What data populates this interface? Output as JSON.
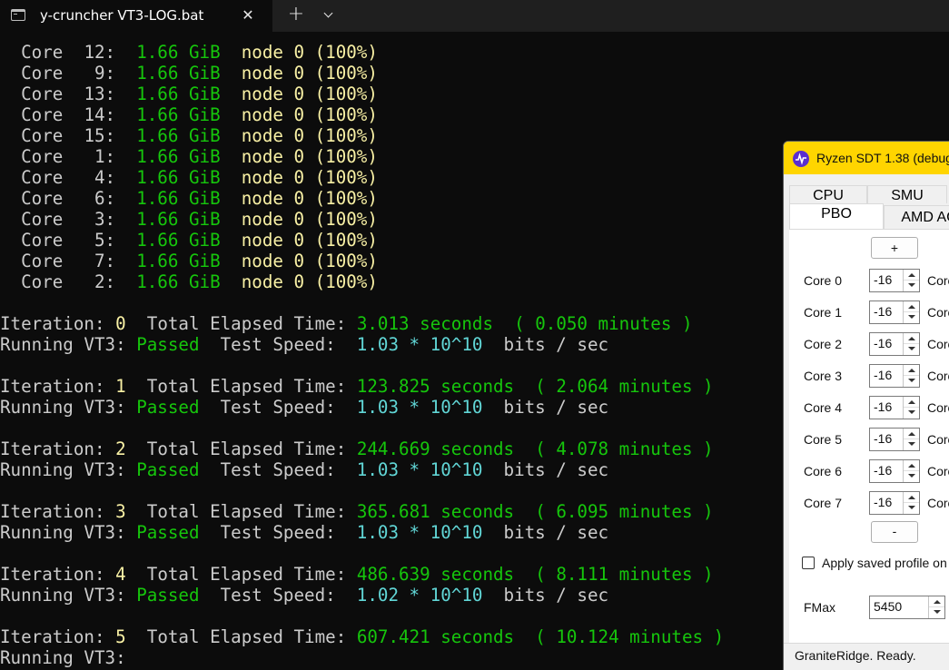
{
  "terminal": {
    "tab_title": "y-cruncher VT3-LOG.bat",
    "close_glyph": "✕",
    "new_tab_glyph": "+",
    "core_rows": [
      {
        "label": "Core",
        "num": "12:",
        "mem": "1.66 GiB",
        "node": "node 0 (100%)"
      },
      {
        "label": "Core",
        "num": " 9:",
        "mem": "1.66 GiB",
        "node": "node 0 (100%)"
      },
      {
        "label": "Core",
        "num": "13:",
        "mem": "1.66 GiB",
        "node": "node 0 (100%)"
      },
      {
        "label": "Core",
        "num": "14:",
        "mem": "1.66 GiB",
        "node": "node 0 (100%)"
      },
      {
        "label": "Core",
        "num": "15:",
        "mem": "1.66 GiB",
        "node": "node 0 (100%)"
      },
      {
        "label": "Core",
        "num": " 1:",
        "mem": "1.66 GiB",
        "node": "node 0 (100%)"
      },
      {
        "label": "Core",
        "num": " 4:",
        "mem": "1.66 GiB",
        "node": "node 0 (100%)"
      },
      {
        "label": "Core",
        "num": " 6:",
        "mem": "1.66 GiB",
        "node": "node 0 (100%)"
      },
      {
        "label": "Core",
        "num": " 3:",
        "mem": "1.66 GiB",
        "node": "node 0 (100%)"
      },
      {
        "label": "Core",
        "num": " 5:",
        "mem": "1.66 GiB",
        "node": "node 0 (100%)"
      },
      {
        "label": "Core",
        "num": " 7:",
        "mem": "1.66 GiB",
        "node": "node 0 (100%)"
      },
      {
        "label": "Core",
        "num": " 2:",
        "mem": "1.66 GiB",
        "node": "node 0 (100%)"
      }
    ],
    "iterations": [
      {
        "label": "Iteration:",
        "num": "0",
        "elapsed_label": "Total Elapsed Time:",
        "seconds": "3.013 seconds",
        "minutes": "( 0.050 minutes )",
        "running": "Running VT3:",
        "status": "Passed",
        "speed_label": "Test Speed:",
        "speed": "1.03 * 10^10",
        "unit": "bits / sec"
      },
      {
        "label": "Iteration:",
        "num": "1",
        "elapsed_label": "Total Elapsed Time:",
        "seconds": "123.825 seconds",
        "minutes": "( 2.064 minutes )",
        "running": "Running VT3:",
        "status": "Passed",
        "speed_label": "Test Speed:",
        "speed": "1.03 * 10^10",
        "unit": "bits / sec"
      },
      {
        "label": "Iteration:",
        "num": "2",
        "elapsed_label": "Total Elapsed Time:",
        "seconds": "244.669 seconds",
        "minutes": "( 4.078 minutes )",
        "running": "Running VT3:",
        "status": "Passed",
        "speed_label": "Test Speed:",
        "speed": "1.03 * 10^10",
        "unit": "bits / sec"
      },
      {
        "label": "Iteration:",
        "num": "3",
        "elapsed_label": "Total Elapsed Time:",
        "seconds": "365.681 seconds",
        "minutes": "( 6.095 minutes )",
        "running": "Running VT3:",
        "status": "Passed",
        "speed_label": "Test Speed:",
        "speed": "1.03 * 10^10",
        "unit": "bits / sec"
      },
      {
        "label": "Iteration:",
        "num": "4",
        "elapsed_label": "Total Elapsed Time:",
        "seconds": "486.639 seconds",
        "minutes": "( 8.111 minutes )",
        "running": "Running VT3:",
        "status": "Passed",
        "speed_label": "Test Speed:",
        "speed": "1.02 * 10^10",
        "unit": "bits / sec"
      },
      {
        "label": "Iteration:",
        "num": "5",
        "elapsed_label": "Total Elapsed Time:",
        "seconds": "607.421 seconds",
        "minutes": "( 10.124 minutes )",
        "running": "Running VT3:",
        "status": "",
        "speed_label": "",
        "speed": "",
        "unit": ""
      }
    ],
    "colors": {
      "background": "#0c0c0c",
      "text": "#cccccc",
      "green": "#16c60c",
      "yellow": "#f9f1a5",
      "cyan": "#61d6d6"
    }
  },
  "sdt": {
    "title": "Ryzen SDT 1.38 (debug",
    "tabs_row1": [
      "CPU",
      "SMU"
    ],
    "tabs_row2": [
      "PBO",
      "AMD AC"
    ],
    "plus_label": "+",
    "minus_label": "-",
    "cores": [
      {
        "label": "Core 0",
        "value": "-16",
        "right": "Core"
      },
      {
        "label": "Core 1",
        "value": "-16",
        "right": "Core"
      },
      {
        "label": "Core 2",
        "value": "-16",
        "right": "Core"
      },
      {
        "label": "Core 3",
        "value": "-16",
        "right": "Core"
      },
      {
        "label": "Core 4",
        "value": "-16",
        "right": "Core"
      },
      {
        "label": "Core 5",
        "value": "-16",
        "right": "Core"
      },
      {
        "label": "Core 6",
        "value": "-16",
        "right": "Core"
      },
      {
        "label": "Core 7",
        "value": "-16",
        "right": "Core"
      }
    ],
    "apply_label": "Apply saved profile on st",
    "fmax_label": "FMax",
    "fmax_value": "5450",
    "status": "GraniteRidge. Ready.",
    "colors": {
      "title_bar": "#ffd500",
      "logo": "#5a2ed0"
    }
  }
}
